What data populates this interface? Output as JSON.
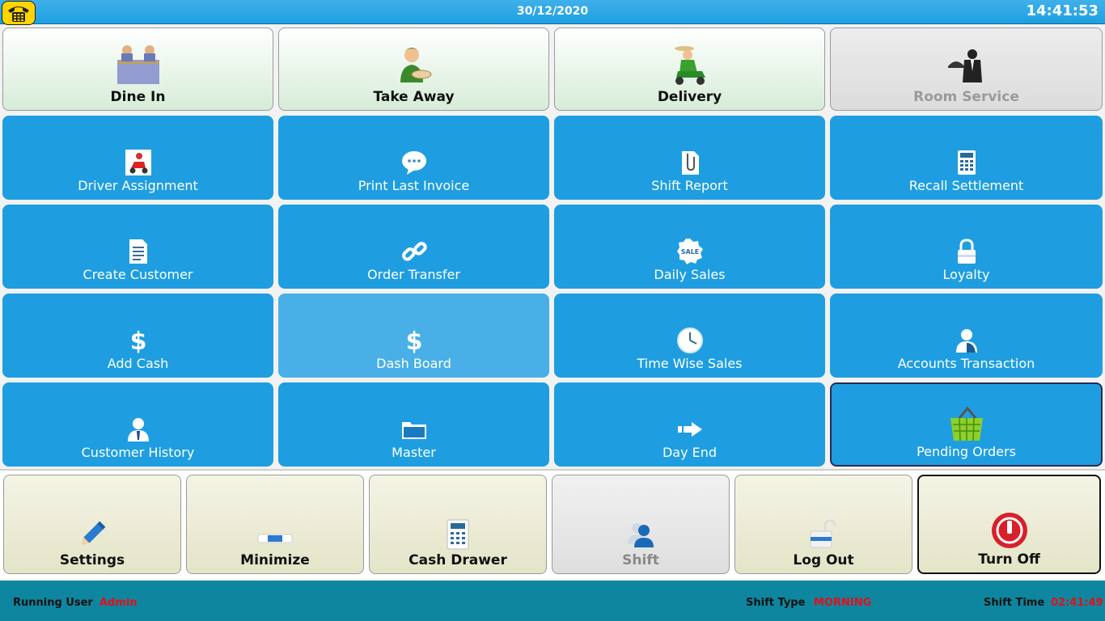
{
  "header": {
    "date": "30/12/2020",
    "time": "14:41:53"
  },
  "order_types": [
    {
      "label": "Dine In",
      "icon": "dine-in-icon",
      "enabled": true
    },
    {
      "label": "Take Away",
      "icon": "take-away-icon",
      "enabled": true
    },
    {
      "label": "Delivery",
      "icon": "delivery-icon",
      "enabled": true
    },
    {
      "label": "Room Service",
      "icon": "room-service-icon",
      "enabled": false
    }
  ],
  "functions": [
    {
      "label": "Driver Assignment",
      "icon": "delivery-scooter-icon"
    },
    {
      "label": "Print Last Invoice",
      "icon": "chat-bubble-icon"
    },
    {
      "label": "Shift Report",
      "icon": "paperclip-document-icon"
    },
    {
      "label": "Recall Settlement",
      "icon": "calculator-icon"
    },
    {
      "label": "Create Customer",
      "icon": "document-icon"
    },
    {
      "label": "Order Transfer",
      "icon": "link-icon"
    },
    {
      "label": "Daily Sales",
      "icon": "sale-badge-icon"
    },
    {
      "label": "Loyalty",
      "icon": "lock-icon"
    },
    {
      "label": "Add Cash",
      "icon": "dollar-icon"
    },
    {
      "label": "Dash Board",
      "icon": "dollar-icon"
    },
    {
      "label": "Time Wise Sales",
      "icon": "clock-icon"
    },
    {
      "label": "Accounts Transaction",
      "icon": "user-icon"
    },
    {
      "label": "Customer History",
      "icon": "businessman-icon"
    },
    {
      "label": "Master",
      "icon": "folder-icon"
    },
    {
      "label": "Day End",
      "icon": "arrow-right-icon"
    },
    {
      "label": "Pending Orders",
      "icon": "basket-icon"
    }
  ],
  "footer_buttons": [
    {
      "label": "Settings",
      "icon": "pencil-icon"
    },
    {
      "label": "Minimize",
      "icon": "minimize-icon"
    },
    {
      "label": "Cash Drawer",
      "icon": "calculator-icon"
    },
    {
      "label": "Shift",
      "icon": "users-icon"
    },
    {
      "label": "Log Out",
      "icon": "unlock-icon"
    },
    {
      "label": "Turn Off",
      "icon": "power-icon"
    }
  ],
  "status": {
    "running_user_label": "Running User",
    "running_user": "Admin",
    "shift_type_label": "Shift Type",
    "shift_type": "MORNING",
    "shift_time_label": "Shift Time",
    "shift_time": "02:41:49"
  },
  "colors": {
    "tile_blue": "#1e9ee0",
    "status_bar": "#0f86a0",
    "value_red": "#e0101a",
    "top_bar": "#1ea0e0"
  }
}
